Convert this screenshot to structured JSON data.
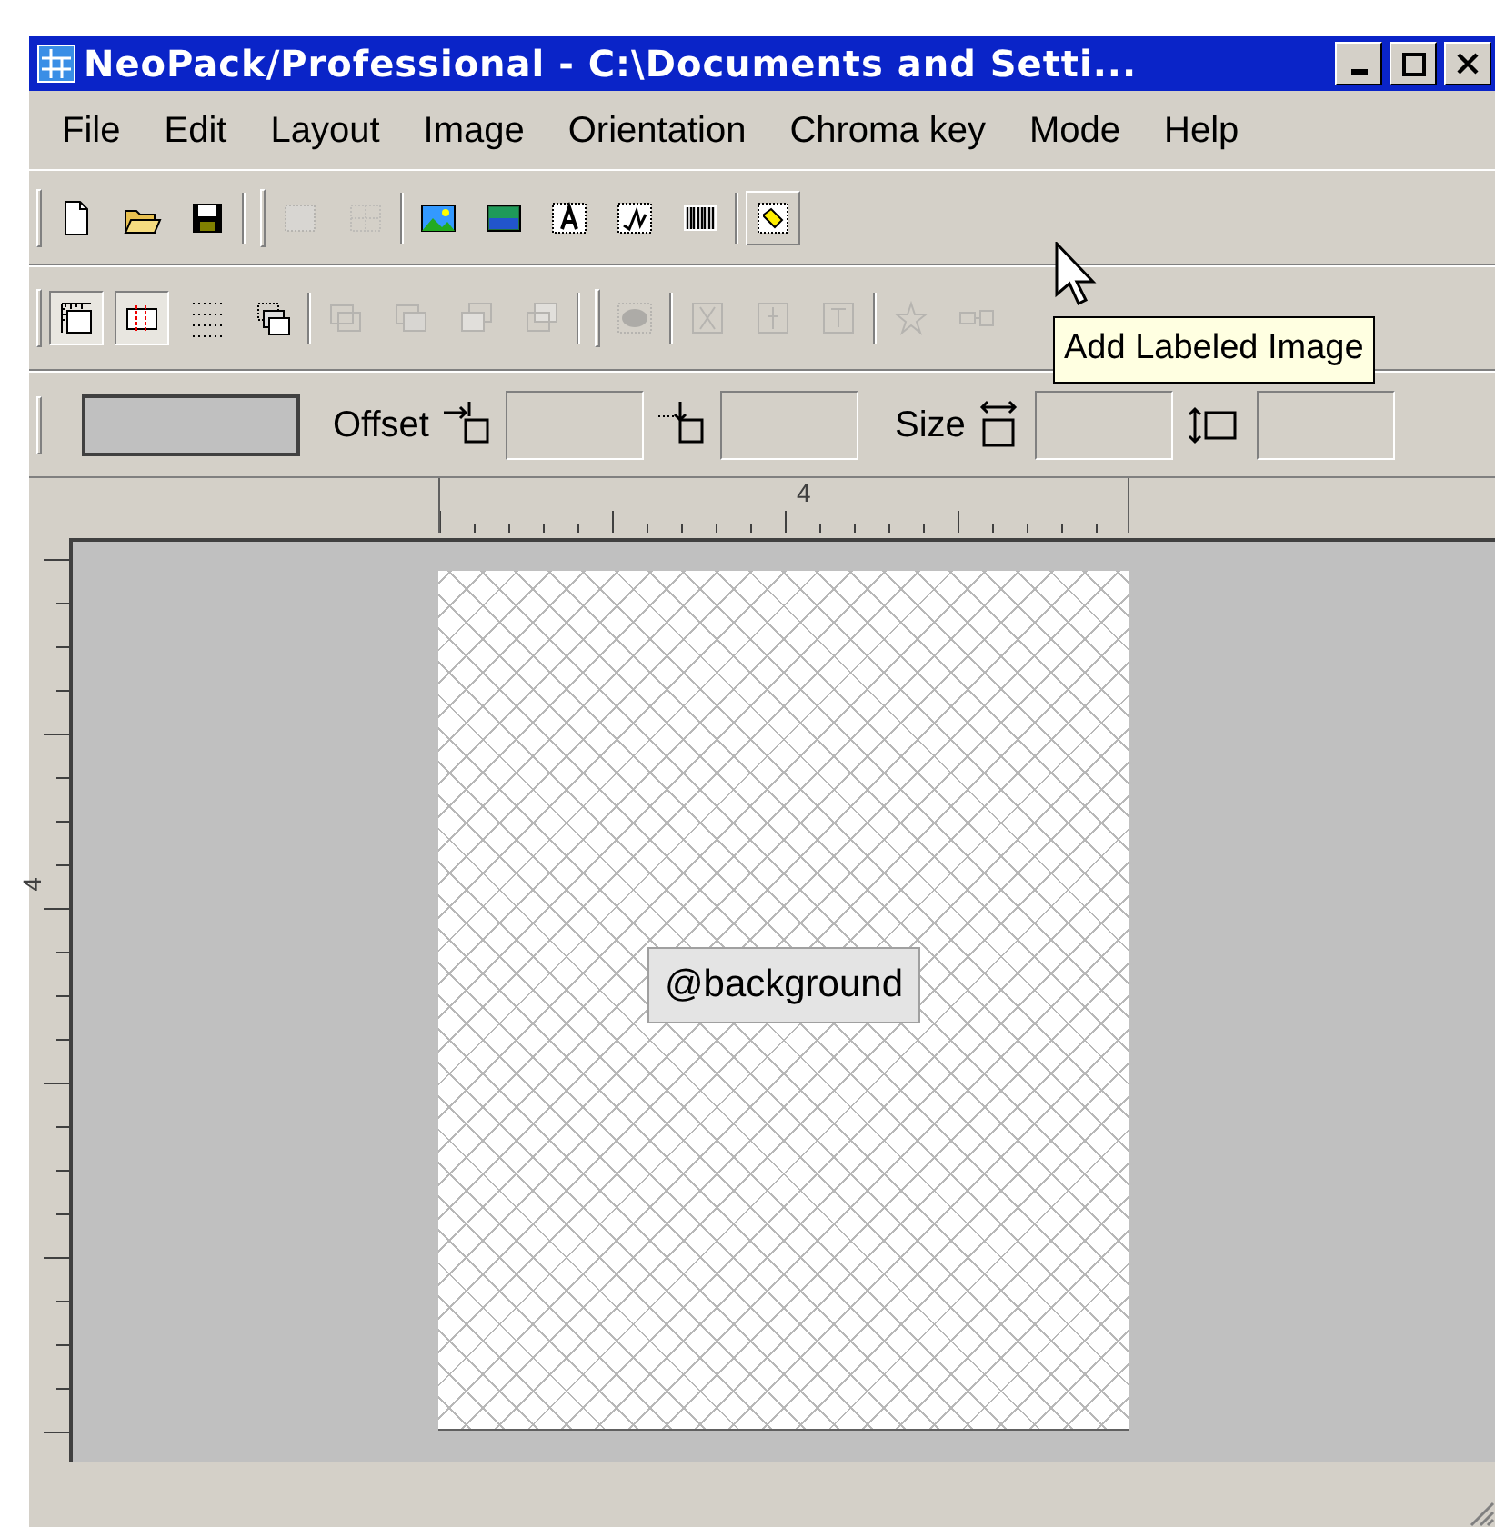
{
  "window": {
    "title": "NeoPack/Professional - C:\\Documents and Setti..."
  },
  "menu": [
    "File",
    "Edit",
    "Layout",
    "Image",
    "Orientation",
    "Chroma key",
    "Mode",
    "Help"
  ],
  "toolbar_1": [
    {
      "disabled": false,
      "highlighted": false
    },
    {
      "disabled": false,
      "highlighted": false
    },
    {
      "disabled": false,
      "highlighted": false
    },
    {
      "disabled": true,
      "highlighted": false
    },
    {
      "disabled": true,
      "highlighted": false
    },
    {
      "disabled": false,
      "highlighted": false
    },
    {
      "disabled": false,
      "highlighted": false
    },
    {
      "disabled": false,
      "highlighted": false
    },
    {
      "disabled": false,
      "highlighted": false
    },
    {
      "disabled": false,
      "highlighted": false
    },
    {
      "disabled": false,
      "highlighted": true
    }
  ],
  "toolbar_2": [
    {
      "disabled": false,
      "pressed": true
    },
    {
      "disabled": false,
      "pressed": true
    },
    {
      "disabled": false,
      "pressed": false
    },
    {
      "disabled": false,
      "pressed": false
    },
    {
      "disabled": true,
      "pressed": false
    },
    {
      "disabled": true,
      "pressed": false
    },
    {
      "disabled": true,
      "pressed": false
    },
    {
      "disabled": true,
      "pressed": false
    },
    {
      "disabled": true,
      "pressed": false
    },
    {
      "disabled": true,
      "pressed": false
    },
    {
      "disabled": true,
      "pressed": false
    },
    {
      "disabled": true,
      "pressed": false
    },
    {
      "disabled": true,
      "pressed": false
    },
    {
      "disabled": true,
      "pressed": false
    }
  ],
  "toolbar_3": {
    "offset_label": "Offset",
    "size_label": "Size"
  },
  "tooltip": "Add Labeled Image",
  "ruler_horizontal": {
    "label": "4"
  },
  "ruler_vertical": {
    "label": "4"
  },
  "canvas": {
    "object_label": "@background"
  }
}
